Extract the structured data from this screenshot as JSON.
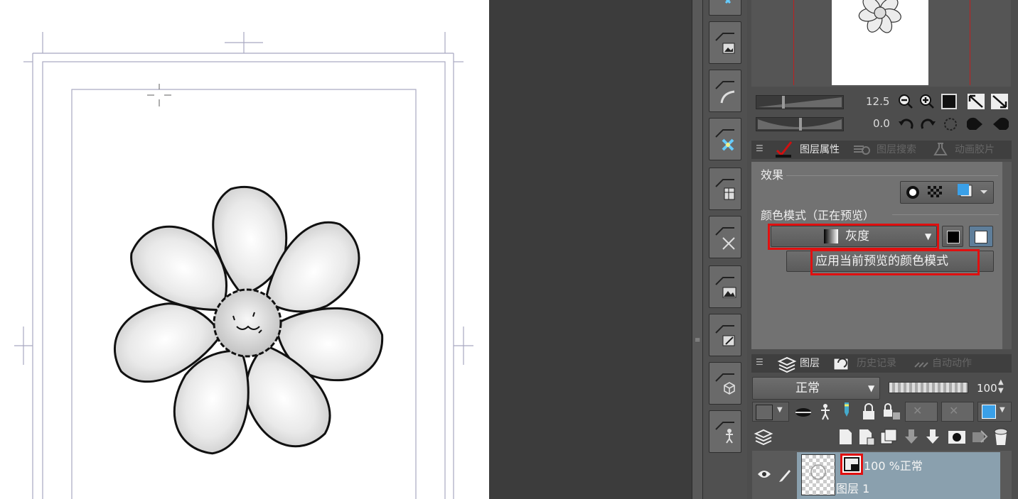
{
  "navigator": {
    "zoom_value": "12.5",
    "rotate_value": "0.0"
  },
  "property_tabs": [
    {
      "label": "图层属性",
      "active": true
    },
    {
      "label": "图层搜索",
      "active": false
    },
    {
      "label": "动画胶片",
      "active": false
    }
  ],
  "layer_property": {
    "effect_label": "效果",
    "color_mode_label": "颜色模式（正在预览）",
    "color_mode_value": "灰度",
    "apply_button_label": "应用当前预览的颜色模式"
  },
  "layer_tabs": [
    {
      "label": "图层",
      "active": true
    },
    {
      "label": "历史记录",
      "active": false
    },
    {
      "label": "自动动作",
      "active": false
    }
  ],
  "layer_panel": {
    "blend_mode": "正常",
    "opacity": "100"
  },
  "layers": [
    {
      "name": "图层 1",
      "info": "100 %正常"
    }
  ],
  "colors": {
    "highlight": "#e01010",
    "selected_layer": "#8aa0ae",
    "panel": "#727272"
  },
  "icons": [
    "zoom-out-icon",
    "zoom-in-icon",
    "fit-icon",
    "flip-horizontal-icon",
    "flip-vertical-icon",
    "rotate-left-icon",
    "rotate-right-icon",
    "reset-rotation-icon",
    "eye-icon",
    "brush-icon",
    "lock-icon"
  ]
}
